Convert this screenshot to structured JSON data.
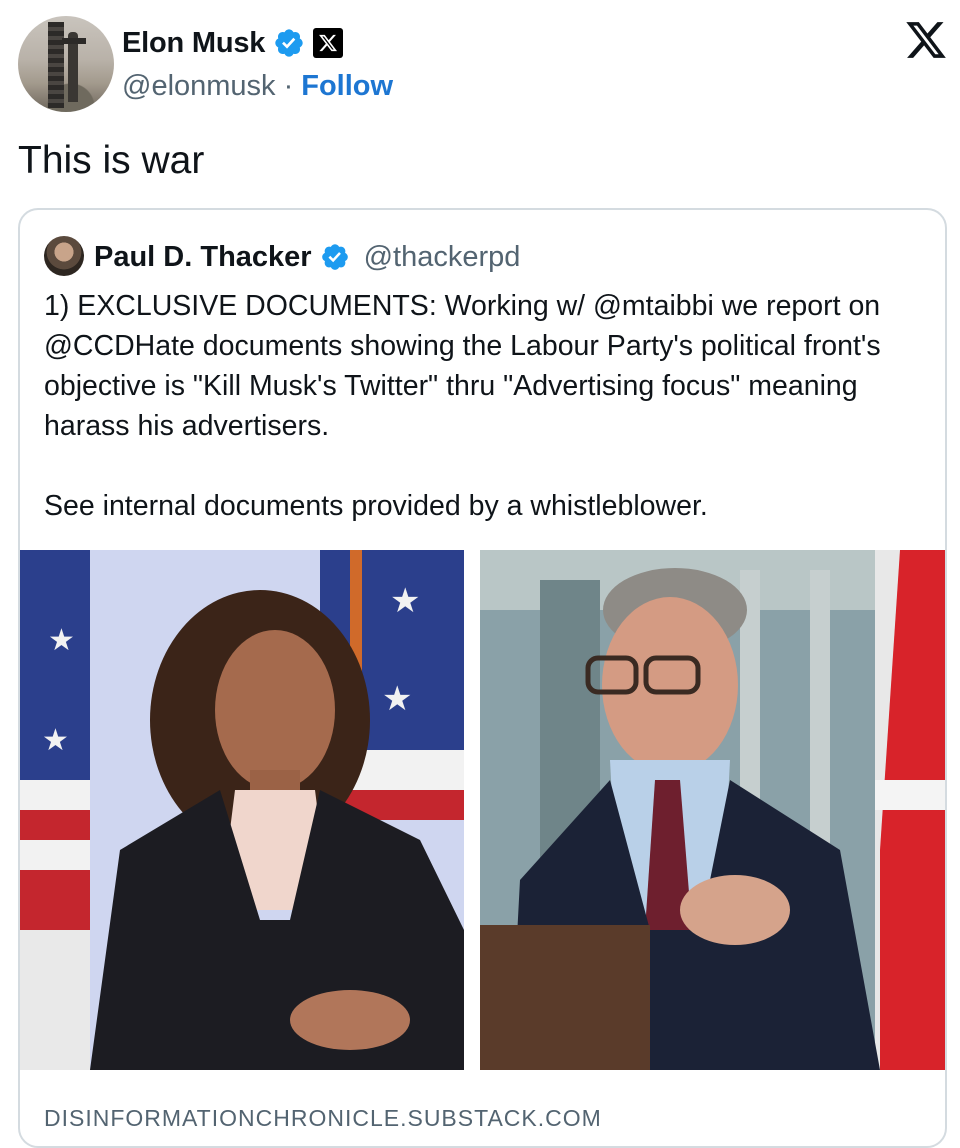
{
  "author": {
    "name": "Elon Musk",
    "handle": "@elonmusk",
    "separator": "·",
    "follow_label": "Follow",
    "verified_icon": "verified-badge-icon",
    "affiliation_icon": "x-affiliation-icon"
  },
  "brand": {
    "logo_icon": "x-logo-icon"
  },
  "tweet": {
    "text": "This is war"
  },
  "quoted_tweet": {
    "name": "Paul D. Thacker",
    "handle": "@thackerpd",
    "paragraph1": "1) EXCLUSIVE DOCUMENTS: Working w/ @mtaibbi we report on @CCDHate documents showing the Labour Party's political front's objective is \"Kill Musk's Twitter\" thru \"Advertising focus\" meaning harass his advertisers.",
    "paragraph2": "See internal documents provided by a whistleblower.",
    "link_domain": "DISINFORMATIONCHRONICLE.SUBSTACK.COM"
  },
  "colors": {
    "follow": "#1d76d2",
    "verified": "#1d9bf0",
    "muted": "#536471",
    "border": "#d4dbe0"
  }
}
